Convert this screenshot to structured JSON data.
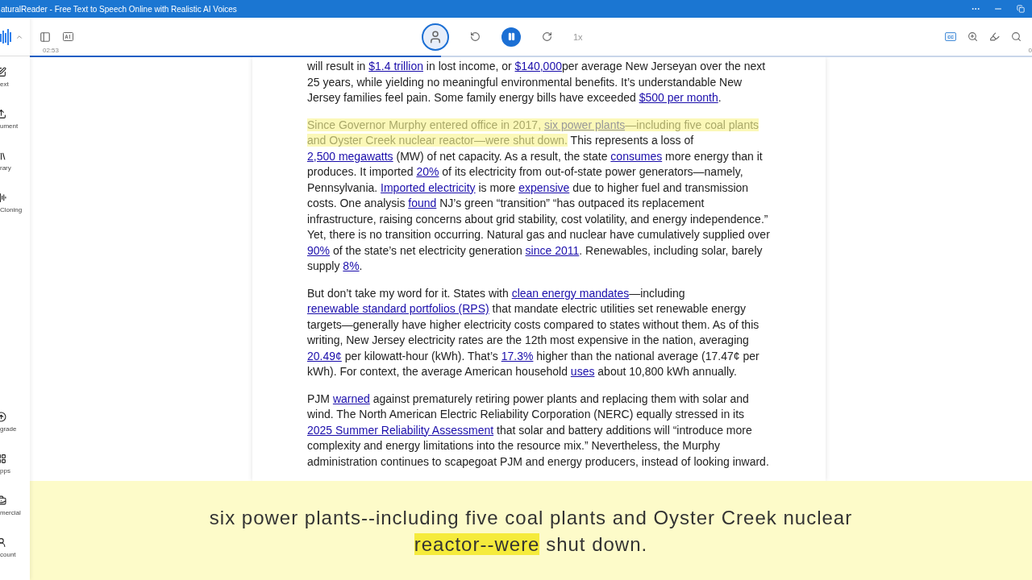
{
  "window": {
    "title": "aturalReader - Free Text to Speech Online with Realistic AI Voices"
  },
  "sidebar": {
    "items": [
      {
        "label": "ext"
      },
      {
        "label": "ument"
      },
      {
        "label": "rary"
      },
      {
        "label": "Cloning"
      }
    ],
    "bottom_items": [
      {
        "label": "grade"
      },
      {
        "label": "pps"
      },
      {
        "label": "mercial"
      },
      {
        "label": "count"
      }
    ]
  },
  "player": {
    "elapsed": "02:53",
    "speed": "1x",
    "playing": true,
    "captions_on": true,
    "captions_label": "cc",
    "level": 0.41,
    "end_time": "0"
  },
  "document": {
    "paragraphs": [
      [
        {
          "kind": "text",
          "text": "will result in "
        },
        {
          "kind": "link",
          "text": "$1.4 trillion"
        },
        {
          "kind": "text",
          "text": " in lost income, or "
        },
        {
          "kind": "link",
          "text": "$140,000"
        },
        {
          "kind": "text",
          "text": "per average New Jerseyan over the next 25 years, while yielding no meaningful environmental benefits. It’s understandable New Jersey families feel pain. Some family energy bills have exceeded "
        },
        {
          "kind": "link",
          "text": "$500 per month"
        },
        {
          "kind": "text",
          "text": "."
        }
      ],
      [
        {
          "kind": "spoken",
          "text": "Since Governor Murphy entered office in 2017, "
        },
        {
          "kind": "spoken_link",
          "text": "six power plants"
        },
        {
          "kind": "spoken",
          "text": "—including five coal plants and Oyster Creek nuclear reactor—were shut down."
        },
        {
          "kind": "text",
          "text": " This represents a loss of "
        },
        {
          "kind": "link",
          "text": "2,500 megawatts"
        },
        {
          "kind": "text",
          "text": " (MW) of net capacity. As a result, the state "
        },
        {
          "kind": "link",
          "text": "consumes"
        },
        {
          "kind": "text",
          "text": " more energy than it produces. It imported "
        },
        {
          "kind": "link",
          "text": "20%"
        },
        {
          "kind": "text",
          "text": " of its electricity from out-of-state power generators—namely, Pennsylvania. "
        },
        {
          "kind": "link",
          "text": "Imported electricity"
        },
        {
          "kind": "text",
          "text": " is more "
        },
        {
          "kind": "link",
          "text": "expensive"
        },
        {
          "kind": "text",
          "text": " due to higher fuel and transmission costs. One analysis "
        },
        {
          "kind": "link",
          "text": "found"
        },
        {
          "kind": "text",
          "text": " NJ’s green “transition” “has outpaced its replacement infrastructure, raising concerns about grid stability, cost volatility, and energy independence.” Yet, there is no transition occurring. Natural gas and nuclear have cumulatively supplied over "
        },
        {
          "kind": "link",
          "text": "90%"
        },
        {
          "kind": "text",
          "text": " of the state’s net electricity generation "
        },
        {
          "kind": "link",
          "text": "since 2011"
        },
        {
          "kind": "text",
          "text": ". Renewables, including solar, barely supply "
        },
        {
          "kind": "link",
          "text": "8%"
        },
        {
          "kind": "text",
          "text": "."
        }
      ],
      [
        {
          "kind": "text",
          "text": "But don’t take my word for it. States with "
        },
        {
          "kind": "link",
          "text": "clean energy mandates"
        },
        {
          "kind": "text",
          "text": "—including "
        },
        {
          "kind": "link",
          "text": "renewable standard portfolios (RPS)"
        },
        {
          "kind": "text",
          "text": " that mandate electric utilities set renewable energy targets—generally have higher electricity costs compared to states without them. As of this writing, New Jersey electricity rates are the 12th most expensive in the nation, averaging "
        },
        {
          "kind": "link",
          "text": "20.49¢"
        },
        {
          "kind": "text",
          "text": " per kilowatt-hour (kWh). That’s "
        },
        {
          "kind": "link",
          "text": "17.3%"
        },
        {
          "kind": "text",
          "text": " higher than the national average (17.47¢ per kWh). For context, the average American household "
        },
        {
          "kind": "link",
          "text": "uses"
        },
        {
          "kind": "text",
          "text": " about 10,800 kWh annually."
        }
      ],
      [
        {
          "kind": "text",
          "text": "PJM "
        },
        {
          "kind": "link",
          "text": "warned"
        },
        {
          "kind": "text",
          "text": " against prematurely retiring power plants and replacing them with solar and wind. The North American Electric Reliability Corporation (NERC) equally stressed in its "
        },
        {
          "kind": "link",
          "text": "2025 Summer Reliability Assessment"
        },
        {
          "kind": "text",
          "text": " that solar and battery additions will “introduce more complexity and energy limitations into the resource mix.” Nevertheless, the Murphy administration continues to scapegoat PJM and energy producers, instead of looking inward."
        }
      ]
    ]
  },
  "caption": {
    "segments": [
      {
        "kind": "text",
        "text": "six power plants--including five coal plants and Oyster Creek nuclear "
      },
      {
        "kind": "current",
        "text": "reactor--were"
      },
      {
        "kind": "text",
        "text": " shut down."
      }
    ]
  }
}
